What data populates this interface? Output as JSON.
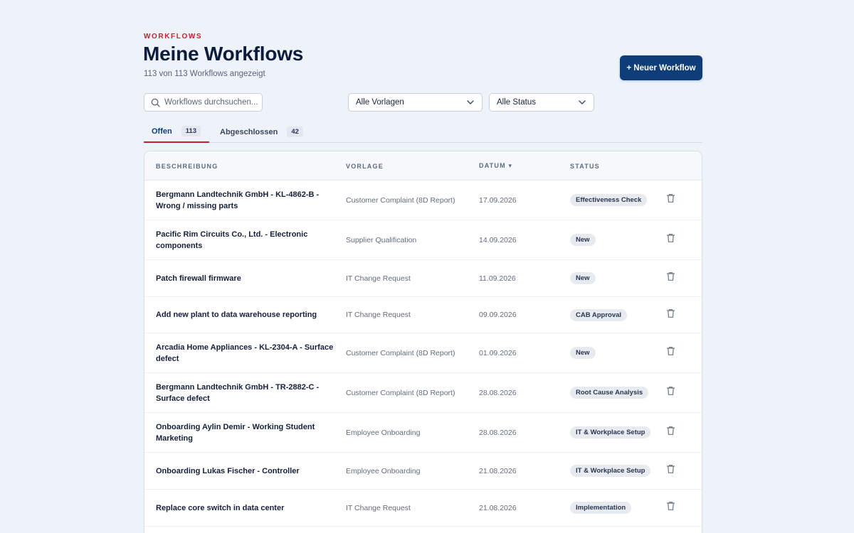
{
  "header": {
    "eyebrow": "WORKFLOWS",
    "title": "Meine Workflows",
    "subtitle": "113 von 113 Workflows angezeigt",
    "new_button": "+ Neuer Workflow"
  },
  "filters": {
    "search_placeholder": "Workflows durchsuchen...",
    "template_select": "Alle Vorlagen",
    "status_select": "Alle Status"
  },
  "tabs": [
    {
      "label": "Offen",
      "count": "113",
      "active": true
    },
    {
      "label": "Abgeschlossen",
      "count": "42",
      "active": false
    }
  ],
  "table": {
    "columns": [
      "BESCHREIBUNG",
      "VORLAGE",
      "DATUM ▾",
      "STATUS"
    ],
    "rows": [
      {
        "description": "Bergmann Landtechnik GmbH - KL-4862-B - Wrong / missing parts",
        "template": "Customer Complaint (8D Report)",
        "date": "17.09.2026",
        "status": "Effectiveness Check"
      },
      {
        "description": "Pacific Rim Circuits Co., Ltd. - Electronic components",
        "template": "Supplier Qualification",
        "date": "14.09.2026",
        "status": "New"
      },
      {
        "description": "Patch firewall firmware",
        "template": "IT Change Request",
        "date": "11.09.2026",
        "status": "New"
      },
      {
        "description": "Add new plant to data warehouse reporting",
        "template": "IT Change Request",
        "date": "09.09.2026",
        "status": "CAB Approval"
      },
      {
        "description": "Arcadia Home Appliances - KL-2304-A - Surface defect",
        "template": "Customer Complaint (8D Report)",
        "date": "01.09.2026",
        "status": "New"
      },
      {
        "description": "Bergmann Landtechnik GmbH - TR-2882-C - Surface defect",
        "template": "Customer Complaint (8D Report)",
        "date": "28.08.2026",
        "status": "Root Cause Analysis"
      },
      {
        "description": "Onboarding Aylin Demir - Working Student Marketing",
        "template": "Employee Onboarding",
        "date": "28.08.2026",
        "status": "IT & Workplace Setup"
      },
      {
        "description": "Onboarding Lukas Fischer - Controller",
        "template": "Employee Onboarding",
        "date": "21.08.2026",
        "status": "IT & Workplace Setup"
      },
      {
        "description": "Replace core switch in data center",
        "template": "IT Change Request",
        "date": "21.08.2026",
        "status": "Implementation"
      }
    ]
  },
  "colors": {
    "accent_red": "#c8212e",
    "primary_navy": "#0f3d7a",
    "background": "#eef3fa"
  },
  "icons": {
    "search": "search-icon",
    "dropdown": "chevron-down-icon",
    "delete": "trash-icon"
  }
}
